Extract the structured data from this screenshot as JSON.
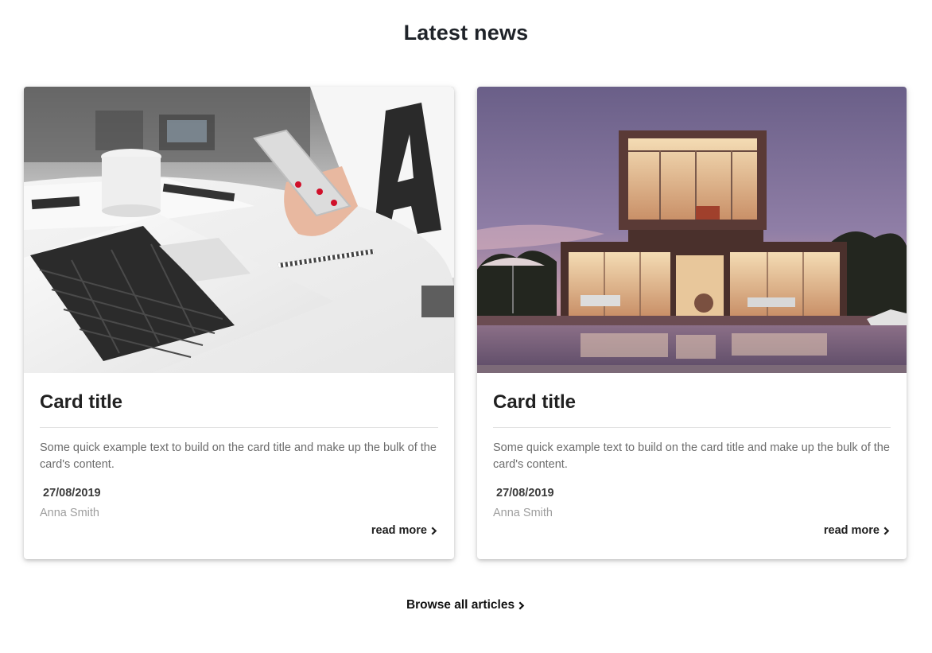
{
  "section": {
    "title": "Latest news"
  },
  "cards": [
    {
      "image_alt": "laptop-and-phone-photo",
      "title": "Card title",
      "text": "Some quick example text to build on the card title and make up the bulk of the card's content.",
      "date": "27/08/2019",
      "author": "Anna Smith",
      "read_more": "read more"
    },
    {
      "image_alt": "modern-house-pool-photo",
      "title": "Card title",
      "text": "Some quick example text to build on the card title and make up the bulk of the card's content.",
      "date": "27/08/2019",
      "author": "Anna Smith",
      "read_more": "read more"
    }
  ],
  "footer": {
    "browse_label": "Browse all articles"
  },
  "icons": {
    "read_more_icon": "chevron-right-icon",
    "browse_icon": "chevron-right-icon"
  },
  "colors": {
    "title_text": "#1f2329",
    "body_text": "#6c6c6c",
    "author_text": "#9e9e9e",
    "divider": "#e3e3e3"
  }
}
